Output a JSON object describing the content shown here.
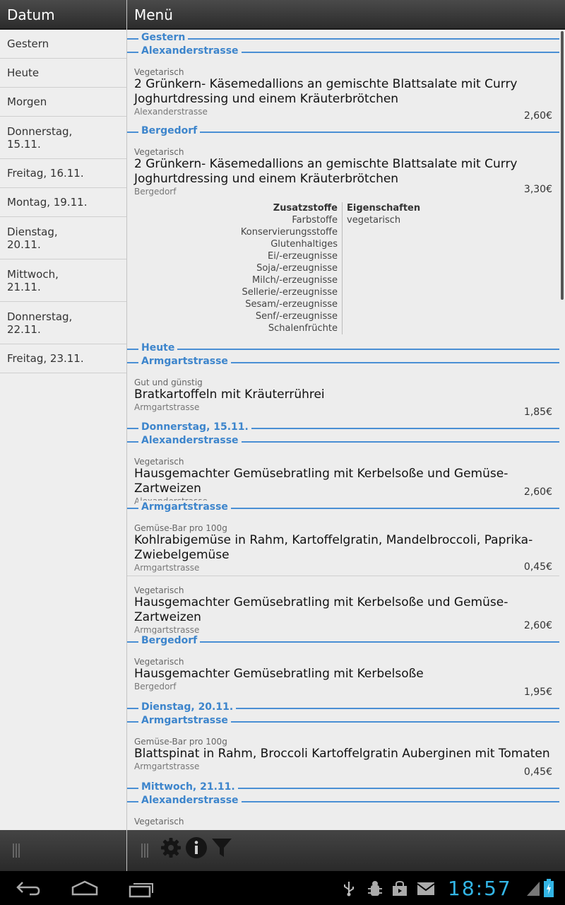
{
  "left": {
    "title": "Datum",
    "dates": [
      "Gestern",
      "Heute",
      "Morgen",
      "Donnerstag,\n15.11.",
      "Freitag, 16.11.",
      "Montag, 19.11.",
      "Dienstag,\n20.11.",
      "Mittwoch,\n21.11.",
      "Donnerstag,\n22.11.",
      "Freitag, 23.11."
    ]
  },
  "right": {
    "title": "Menü",
    "sections": {
      "gestern": "Gestern",
      "alex1": "Alexanderstrasse",
      "bergedorf1": "Bergedorf",
      "heute": "Heute",
      "armgart1": "Armgartstrasse",
      "donnerstag": "Donnerstag, 15.11.",
      "alex2": "Alexanderstrasse",
      "armgart2": "Armgartstrasse",
      "bergedorf2": "Bergedorf",
      "dienstag": "Dienstag, 20.11.",
      "armgart3": "Armgartstrasse",
      "mittwoch": "Mittwoch, 21.11.",
      "alex3": "Alexanderstrasse"
    },
    "items": [
      {
        "cat": "Vegetarisch",
        "name": "2 Grünkern- Käsemedallions an gemischte Blattsalate mit Curry Joghurtdressing und einem Kräuterbrötchen",
        "loc": "Alexanderstrasse",
        "price": "2,60€"
      },
      {
        "cat": "Vegetarisch",
        "name": "2 Grünkern- Käsemedallions an gemischte Blattsalate mit Curry Joghurtdressing und einem Kräuterbrötchen",
        "loc": "Bergedorf",
        "price": "3,30€"
      },
      {
        "cat": "Gut und günstig",
        "name": "Bratkartoffeln mit Kräuterrührei",
        "loc": "Armgartstrasse",
        "price": "1,85€"
      },
      {
        "cat": "Vegetarisch",
        "name": "Hausgemachter Gemüsebratling mit Kerbelsoße und Gemüse- Zartweizen",
        "loc": "Alexanderstrasse",
        "price": "2,60€"
      },
      {
        "cat": "Gemüse-Bar pro 100g",
        "name": "Kohlrabigemüse in Rahm, Kartoffelgratin, Mandelbroccoli, Paprika-Zwiebelgemüse",
        "loc": "Armgartstrasse",
        "price": "0,45€"
      },
      {
        "cat": "Vegetarisch",
        "name": "Hausgemachter Gemüsebratling mit Kerbelsoße und Gemüse- Zartweizen",
        "loc": "Armgartstrasse",
        "price": "2,60€"
      },
      {
        "cat": "Vegetarisch",
        "name": "Hausgemachter Gemüsebratling mit Kerbelsoße",
        "loc": "Bergedorf",
        "price": "1,95€"
      },
      {
        "cat": "Gemüse-Bar pro 100g",
        "name": "Blattspinat in Rahm, Broccoli Kartoffelgratin Auberginen mit Tomaten",
        "loc": "Armgartstrasse",
        "price": "0,45€"
      },
      {
        "cat": "Vegetarisch"
      }
    ],
    "details": {
      "additives_header": "Zusatzstoffe",
      "additives": [
        "Farbstoffe",
        "Konservierungsstoffe",
        "Glutenhaltiges",
        "Ei/-erzeugnisse",
        "Soja/-erzeugnisse",
        "Milch/-erzeugnisse",
        "Sellerie/-erzeugnisse",
        "Sesam/-erzeugnisse",
        "Senf/-erzeugnisse",
        "Schalenfrüchte"
      ],
      "properties_header": "Eigenschaften",
      "properties": [
        "vegetarisch"
      ]
    }
  },
  "toolbar_icons": [
    "settings-icon",
    "info-icon",
    "filter-icon"
  ],
  "status": {
    "time": "18:57"
  },
  "colors": {
    "accent": "#3d85cc",
    "clock": "#33b5e5"
  }
}
